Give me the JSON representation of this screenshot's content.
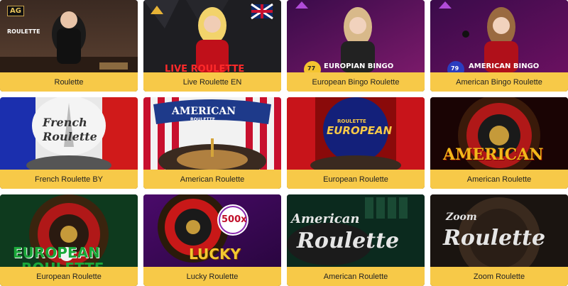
{
  "games": [
    {
      "label": "Roulette",
      "provider_badge": "AG",
      "thumb_text": "ROULETTE"
    },
    {
      "label": "Live Roulette EN",
      "thumb_text": "LIVE ROULETTE"
    },
    {
      "label": "European Bingo Roulette",
      "thumb_text": "EUROPIAN BINGO",
      "ball_number": "77"
    },
    {
      "label": "American Bingo Roulette",
      "thumb_text": "AMERICAN BINGO",
      "ball_number": "79"
    },
    {
      "label": "French Roulette BY",
      "thumb_text_1": "French",
      "thumb_text_2": "Roulette"
    },
    {
      "label": "American Roulette",
      "thumb_text_1": "AMERICAN",
      "thumb_text_2": "ROULETTE"
    },
    {
      "label": "European Roulette",
      "thumb_text_1": "ROULETTE",
      "thumb_text_2": "EUROPEAN"
    },
    {
      "label": "American Roulette",
      "thumb_text": "AMERICAN"
    },
    {
      "label": "European Roulette",
      "thumb_text_1": "EUROPEAN",
      "thumb_text_2": "ROULETTE"
    },
    {
      "label": "Lucky Roulette",
      "thumb_text": "LUCKY",
      "multiplier": "500x"
    },
    {
      "label": "American Roulette",
      "thumb_text_1": "American",
      "thumb_text_2": "Roulette"
    },
    {
      "label": "Zoom Roulette",
      "thumb_text_1": "Zoom",
      "thumb_text_2": "Roulette"
    }
  ],
  "colors": {
    "label_bar": "#f7c948",
    "label_text": "#222222"
  }
}
